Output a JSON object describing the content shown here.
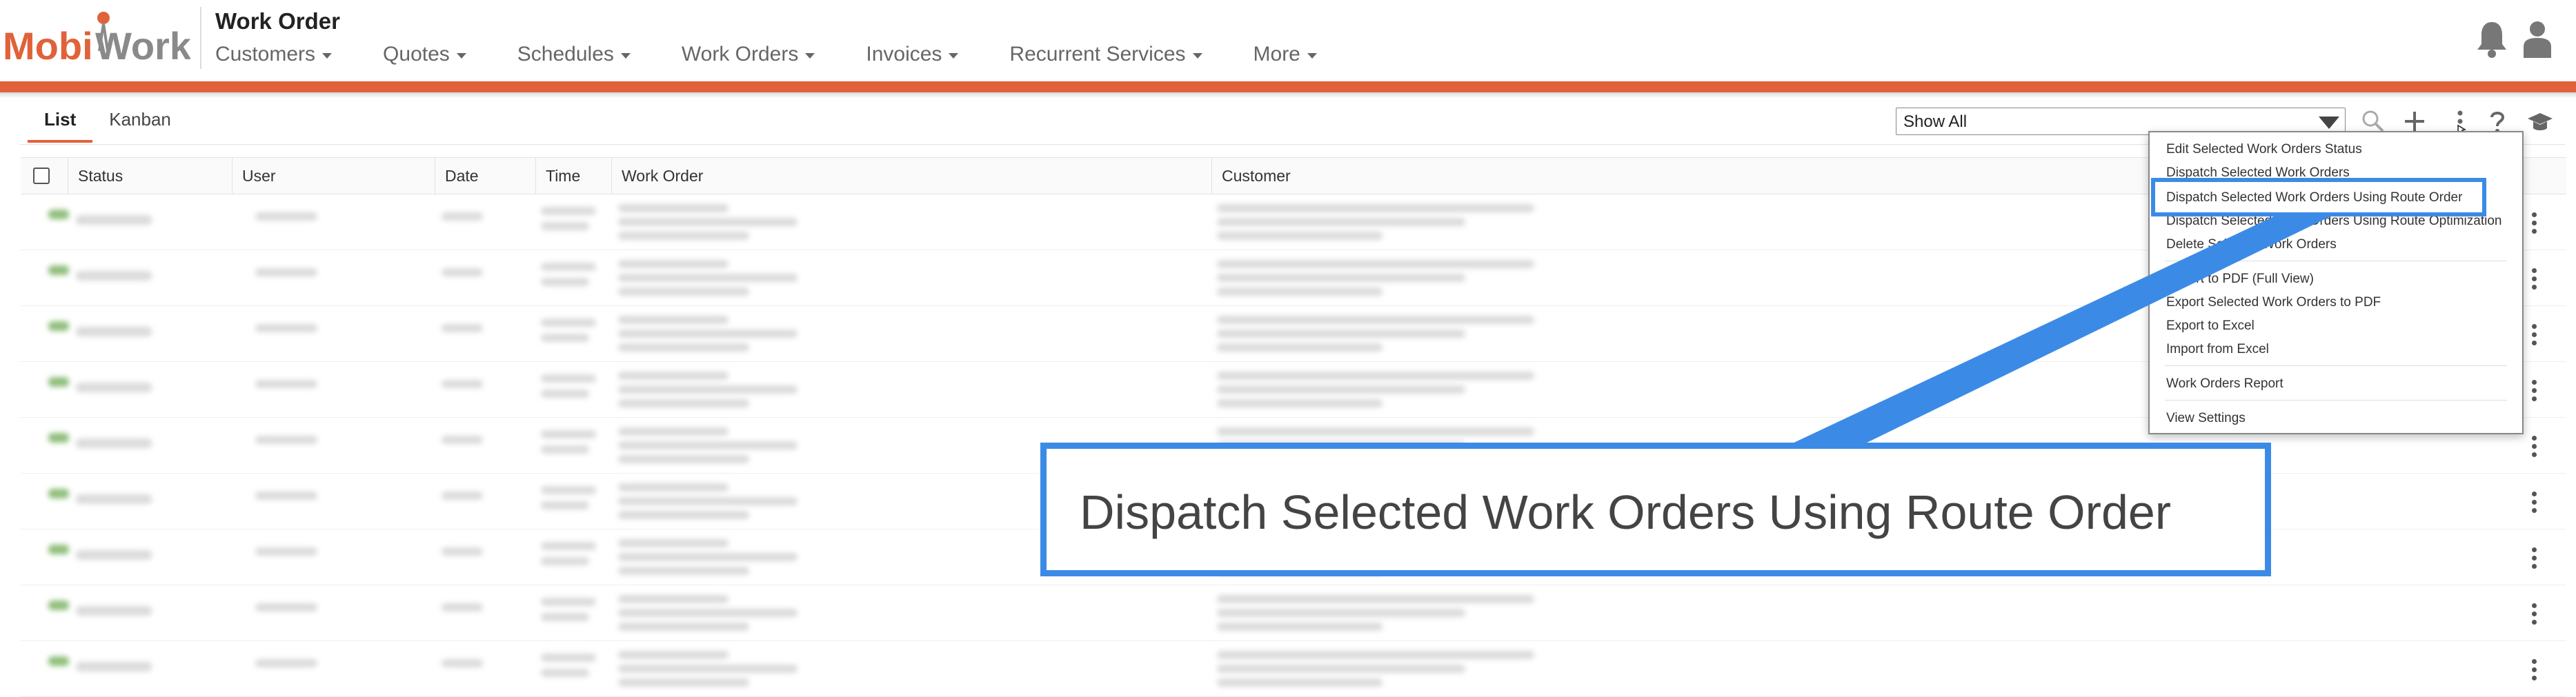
{
  "header": {
    "logo_text_1": "Mobi",
    "logo_text_2": "Work",
    "title": "Work Order",
    "nav": [
      "Customers",
      "Quotes",
      "Schedules",
      "Work Orders",
      "Invoices",
      "Recurrent Services",
      "More"
    ]
  },
  "tabs": [
    "List",
    "Kanban"
  ],
  "filter": {
    "value": "Show All"
  },
  "table": {
    "columns": [
      "Status",
      "User",
      "Date",
      "Time",
      "Work Order",
      "Customer"
    ]
  },
  "menu": {
    "items": [
      "Edit Selected Work Orders Status",
      "Dispatch Selected Work Orders",
      "Dispatch Selected Work Orders Using Route Order",
      "Dispatch Selected Work Orders Using Route Optimization",
      "Delete Selected Work Orders",
      "Export to PDF (Full View)",
      "Export Selected Work Orders to PDF",
      "Export to Excel",
      "Import from Excel",
      "Work Orders Report",
      "View Settings"
    ],
    "highlighted_index": 2
  },
  "callout": {
    "text": "Dispatch Selected Work Orders Using Route Order"
  },
  "colors": {
    "accent": "#e0623a",
    "highlight": "#3b8be6",
    "status_green": "#6aa84f"
  },
  "icons": [
    "bell-icon",
    "user-icon",
    "search-icon",
    "plus-icon",
    "more-vertical-icon",
    "help-icon",
    "graduation-cap-icon",
    "chevron-down-icon"
  ]
}
